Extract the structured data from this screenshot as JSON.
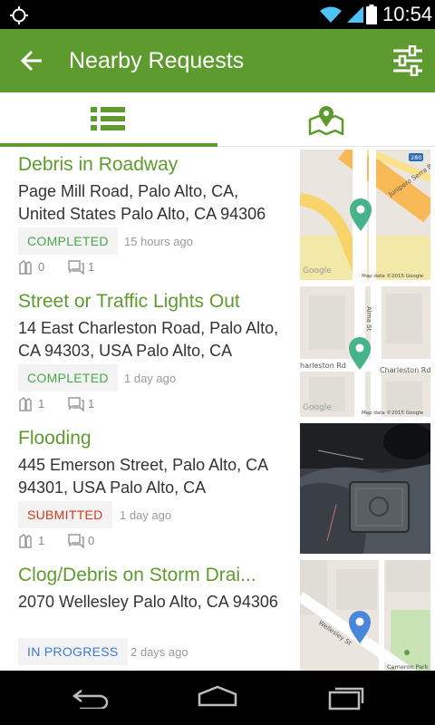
{
  "status_bar": {
    "time": "10:54",
    "icons": [
      "gps-icon",
      "wifi-icon",
      "cell-signal-icon",
      "battery-icon"
    ]
  },
  "app_bar": {
    "title": "Nearby Requests",
    "back_icon": "arrow-left-icon",
    "filter_icon": "sliders-icon",
    "color": "#5e9b2e"
  },
  "tabs": [
    {
      "icon": "list-icon",
      "selected": true
    },
    {
      "icon": "map-pin-icon",
      "selected": false
    }
  ],
  "requests": [
    {
      "title": "Debris in Roadway",
      "address": "Page Mill Road, Palo Alto, CA, United States Palo Alto, CA 94306",
      "status": "COMPLETED",
      "time_ago": "15 hours ago",
      "votes": "0",
      "comments": "1",
      "thumb": {
        "kind": "map",
        "labels": [
          "Junipero Serra Blvd",
          "280"
        ],
        "google": "Google",
        "attribution": "Map data ©2015 Google"
      }
    },
    {
      "title": "Street or Traffic Lights Out",
      "address": "14 East Charleston Road, Palo Alto, CA 94303, USA Palo Alto, CA",
      "status": "COMPLETED",
      "time_ago": "1 day ago",
      "votes": "1",
      "comments": "1",
      "thumb": {
        "kind": "map",
        "labels": [
          "Charleston Rd",
          "harleston Rd",
          "Alma St"
        ],
        "google": "Google",
        "attribution": "Map data ©2015 Google"
      }
    },
    {
      "title": "Flooding",
      "address": "445 Emerson Street, Palo Alto, CA 94301, USA Palo Alto, CA",
      "status": "SUBMITTED",
      "time_ago": "1 day ago",
      "votes": "1",
      "comments": "0",
      "thumb": {
        "kind": "photo"
      }
    },
    {
      "title": "Clog/Debris on Storm Drai...",
      "address": "2070 Wellesley  Palo Alto, CA 94306",
      "status": "IN PROGRESS",
      "time_ago": "2 days ago",
      "votes": "",
      "comments": "",
      "thumb": {
        "kind": "map",
        "labels": [
          "Wellesley St",
          "Cameron Park"
        ],
        "google": "",
        "attribution": ""
      }
    }
  ],
  "nav_bar": {
    "icons": [
      "back-nav-icon",
      "home-nav-icon",
      "recents-nav-icon"
    ]
  }
}
